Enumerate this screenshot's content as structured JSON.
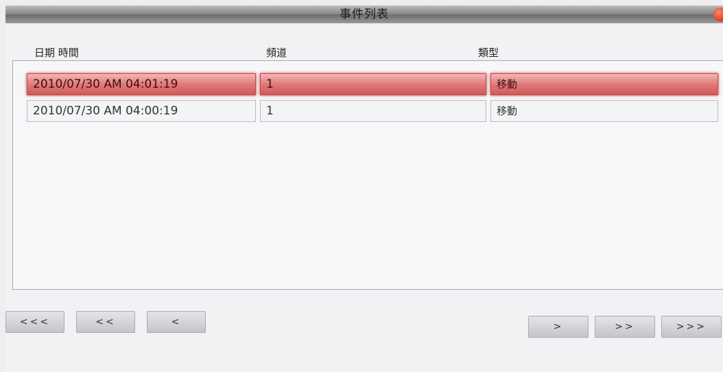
{
  "window": {
    "title": "事件列表"
  },
  "columns": {
    "datetime": "日期 時間",
    "channel": "頻道",
    "type": "類型"
  },
  "events": [
    {
      "datetime": "2010/07/30 AM 04:01:19",
      "channel": "1",
      "type": "移動",
      "selected": true
    },
    {
      "datetime": "2010/07/30 AM 04:00:19",
      "channel": "1",
      "type": "移動",
      "selected": false
    }
  ],
  "pagination": {
    "first": "<<<",
    "prev_page": "<<",
    "prev": "<",
    "next": ">",
    "next_page": ">>",
    "last": ">>>"
  },
  "colors": {
    "selected_row": "#d96a6a",
    "titlebar": "#8a8a8a"
  }
}
